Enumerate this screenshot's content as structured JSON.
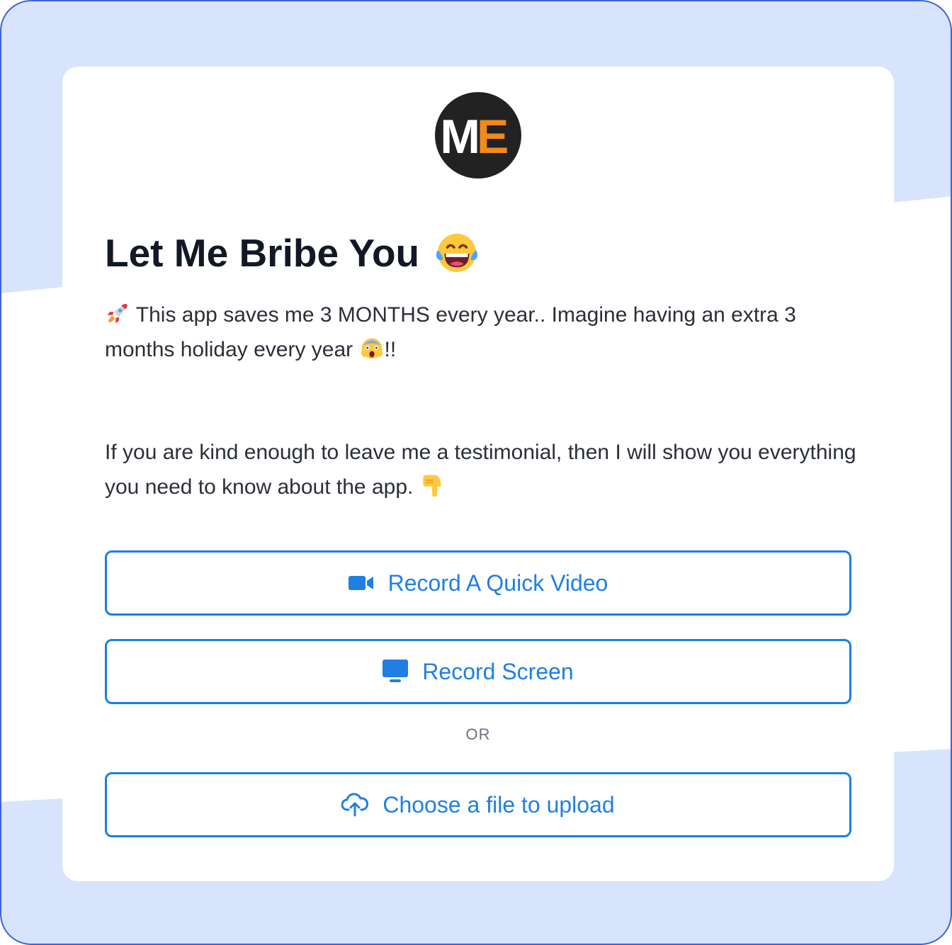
{
  "logo": {
    "letters_left": "M",
    "letters_right": "E",
    "left_color": "#ffffff",
    "right_color": "#f08a1c",
    "background": "#222222"
  },
  "header": {
    "title": "Let Me Bribe You",
    "title_emoji_icon": "laughing-tears-emoji"
  },
  "intro": {
    "lead_icon": "rocket-emoji",
    "text": "This app saves me 3 MONTHS every year.. Imagine having an extra 3 months holiday every year",
    "trail_icon": "screaming-face-emoji",
    "suffix": "!!"
  },
  "request": {
    "text": "If you are kind enough to leave me a testimonial, then I will show you everything you need to know about the app.",
    "trail_icon": "pointing-down-emoji"
  },
  "actions": {
    "record_video": {
      "label": "Record A Quick Video",
      "icon": "video-camera-icon"
    },
    "record_screen": {
      "label": "Record Screen",
      "icon": "monitor-icon"
    },
    "separator": "OR",
    "upload": {
      "label": "Choose a file to upload",
      "icon": "cloud-upload-icon"
    }
  },
  "colors": {
    "accent": "#1f7fe3",
    "frame_background": "#d8e4fc",
    "frame_border": "#3f63d8"
  }
}
